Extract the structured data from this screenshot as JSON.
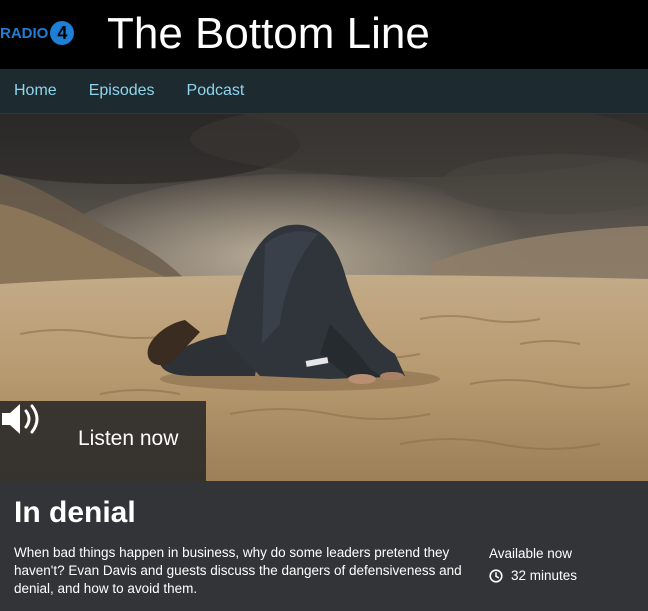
{
  "header": {
    "network_name": "RADIO",
    "network_number": "4",
    "show_title": "The Bottom Line"
  },
  "nav": {
    "items": [
      {
        "label": "Home"
      },
      {
        "label": "Episodes"
      },
      {
        "label": "Podcast"
      }
    ]
  },
  "hero": {
    "image_icon": "speaker-icon"
  },
  "player": {
    "listen_label": "Listen now",
    "icon": "speaker-icon"
  },
  "episode": {
    "title": "In denial",
    "description": "When bad things happen in business, why do some leaders pretend they haven't? Evan Davis and guests discuss the dangers of defensiveness and denial, and how to avoid them.",
    "availability": "Available now",
    "duration": "32 minutes",
    "duration_icon": "clock-icon"
  },
  "colors": {
    "brand_blue": "#1e7fd6",
    "nav_background": "#1d2a30",
    "nav_link": "#8fd5ec",
    "panel_background": "#323437"
  }
}
